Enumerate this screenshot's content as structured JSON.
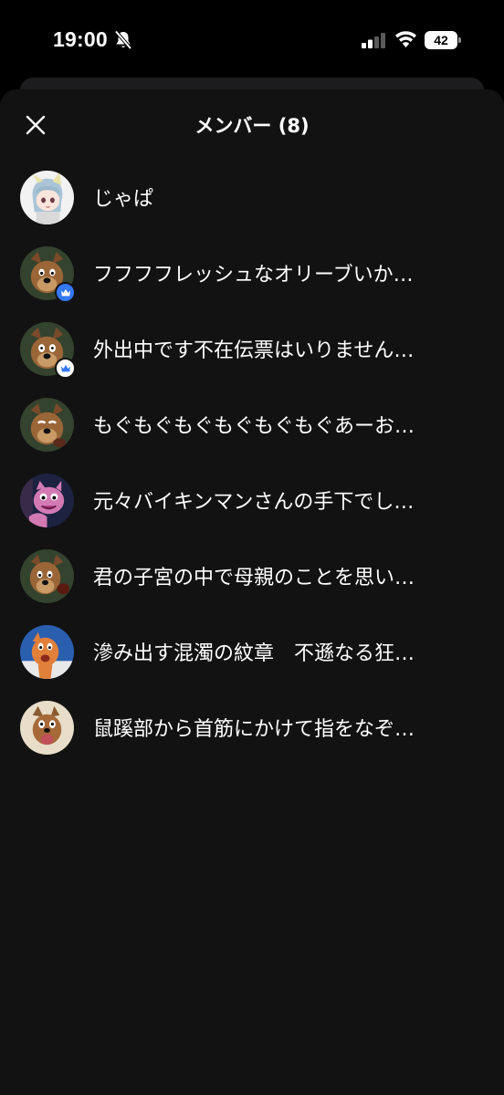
{
  "status_bar": {
    "time": "19:00",
    "battery": "42",
    "icons": [
      "bell-slash-icon",
      "signal-icon",
      "wifi-icon",
      "battery-icon"
    ]
  },
  "sheet": {
    "title": "メンバー (8)",
    "close_icon": "close-icon"
  },
  "colors": {
    "background": "#000000",
    "sheet": "#121212",
    "owner_badge": "#3478f6",
    "admin_badge": "#ffffff"
  },
  "members": [
    {
      "name": "じゃぱ",
      "avatar": "anime-girl",
      "badge": ""
    },
    {
      "name": "フフフフレッシュなオリーブいか…",
      "avatar": "brown-dog",
      "badge": "owner"
    },
    {
      "name": "外出中です不在伝票はいりません…",
      "avatar": "brown-dog",
      "badge": "admin"
    },
    {
      "name": "もぐもぐもぐもぐもぐもぐあーお…",
      "avatar": "brown-dog-eating",
      "badge": ""
    },
    {
      "name": "元々バイキンマンさんの手下でし…",
      "avatar": "pink-character",
      "badge": ""
    },
    {
      "name": "君の子宮の中で母親のことを思い…",
      "avatar": "brown-dog-side",
      "badge": ""
    },
    {
      "name": "滲み出す混濁の紋章　不遜なる狂…",
      "avatar": "orange-dog-blue",
      "badge": ""
    },
    {
      "name": "鼠蹊部から首筋にかけて指をなぞ…",
      "avatar": "brown-dog-shout",
      "badge": ""
    }
  ]
}
